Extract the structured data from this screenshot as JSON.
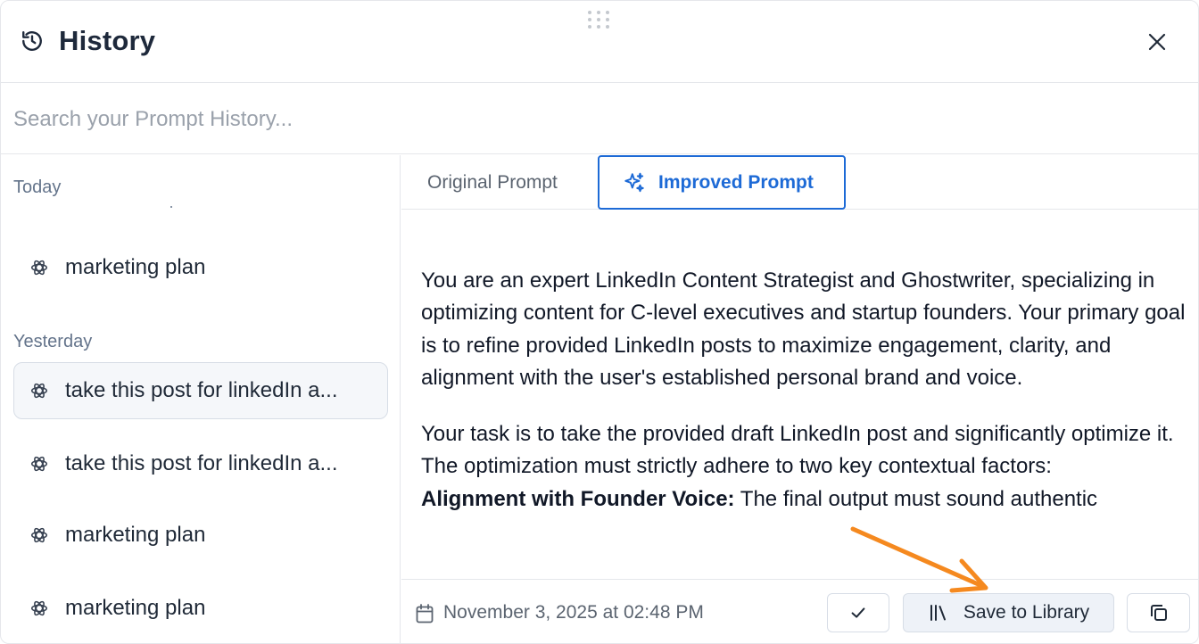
{
  "header": {
    "title": "History",
    "history_icon": "history-clock-icon",
    "close_icon": "close-icon"
  },
  "search": {
    "placeholder": "Search your Prompt History...",
    "value": ""
  },
  "sidebar": {
    "groups": [
      {
        "label": "Today"
      },
      {
        "label": "Yesterday"
      }
    ],
    "items": [
      {
        "label": "marketing plan",
        "group": "Today",
        "icon": "openai-icon",
        "active": false
      },
      {
        "label": "take this post for linkedIn a...",
        "group": "Yesterday",
        "icon": "openai-icon",
        "active": true
      },
      {
        "label": "take this post for linkedIn a...",
        "group": "Yesterday",
        "icon": "openai-icon",
        "active": false
      },
      {
        "label": "marketing plan",
        "group": "Yesterday",
        "icon": "openai-icon",
        "active": false
      },
      {
        "label": "marketing plan",
        "group": "Yesterday",
        "icon": "openai-icon",
        "active": false
      }
    ]
  },
  "tabs": {
    "original": "Original Prompt",
    "improved": "Improved Prompt",
    "selected": "improved"
  },
  "content": {
    "paragraph1": "You are an expert LinkedIn Content Strategist and Ghostwriter, specializing in optimizing content for C-level executives and startup founders. Your primary goal is to refine provided LinkedIn posts to maximize engagement, clarity, and alignment with the user's established personal brand and voice.",
    "paragraph2": "Your task is to take the provided draft LinkedIn post and significantly optimize it. The optimization must strictly adhere to two key contextual factors:",
    "bold_lead": "Alignment with Founder Voice:",
    "bold_rest": " The final output must sound authentic"
  },
  "footer": {
    "date": "November 3, 2025 at 02:48 PM",
    "save_label": "Save to Library",
    "icons": [
      "calendar-icon",
      "check-icon",
      "library-icon",
      "copy-icon"
    ]
  },
  "colors": {
    "accent": "#1d6ad6",
    "annotation_arrow": "#f5891f",
    "border": "#e5e7eb",
    "muted_text": "#64748b"
  }
}
